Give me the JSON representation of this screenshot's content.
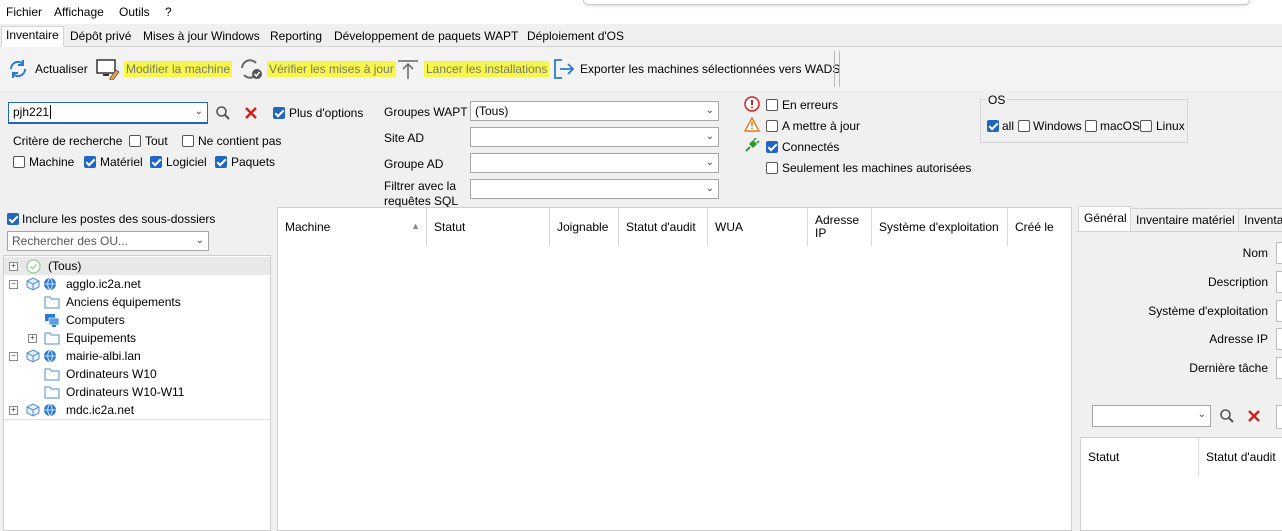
{
  "menu": [
    "Fichier",
    "Affichage",
    "Outils",
    "?"
  ],
  "tabs": [
    {
      "label": "Inventaire",
      "active": true
    },
    {
      "label": "Dépôt privé"
    },
    {
      "label": "Mises à jour Windows"
    },
    {
      "label": "Reporting"
    },
    {
      "label": "Développement de paquets WAPT"
    },
    {
      "label": "Déploiement d'OS"
    }
  ],
  "toolbar": {
    "refresh": "Actualiser",
    "edit_machine": "Modifier la machine",
    "check_updates": "Vérifier les mises à jour",
    "launch_installs": "Lancer les installations",
    "export_wads": "Exporter les machines sélectionnées vers WADS"
  },
  "search": {
    "value": "pjh221",
    "more_options": "Plus d'options",
    "criteria_label": "Critère de recherche",
    "all": "Tout",
    "not_contains": "Ne contient pas",
    "machine": "Machine",
    "hardware": "Matériel",
    "software": "Logiciel",
    "packages": "Paquets"
  },
  "filters": {
    "wapt_groups_label": "Groupes WAPT",
    "wapt_groups_value": "(Tous)",
    "ad_site_label": "Site AD",
    "ad_group_label": "Groupe AD",
    "sql_label_1": "Filtrer avec la",
    "sql_label_2": "requêtes SQL"
  },
  "status_filters": {
    "errors": "En erreurs",
    "to_update": "A mettre à jour",
    "connected": "Connectés",
    "authorized_only": "Seulement les machines autorisées"
  },
  "os": {
    "title": "OS",
    "all": "all",
    "windows": "Windows",
    "macos": "macOS",
    "linux": "Linux"
  },
  "ou": {
    "include_subfolders": "Inclure les postes des sous-dossiers",
    "search_placeholder": "Rechercher des OU...",
    "tree": [
      {
        "label": "(Tous)"
      },
      {
        "label": "agglo.ic2a.net"
      },
      {
        "label": "Anciens équipements"
      },
      {
        "label": "Computers"
      },
      {
        "label": "Equipements"
      },
      {
        "label": "mairie-albi.lan"
      },
      {
        "label": "Ordinateurs W10"
      },
      {
        "label": "Ordinateurs W10-W11"
      },
      {
        "label": "mdc.ic2a.net"
      }
    ]
  },
  "grid": {
    "columns": [
      "Machine",
      "Statut",
      "Joignable",
      "Statut d'audit",
      "WUA",
      "Adresse IP",
      "Système d'exploitation",
      "Créé le"
    ]
  },
  "details": {
    "tabs": [
      "Général",
      "Inventaire matériel",
      "Inventa"
    ],
    "fields": [
      "Nom",
      "Description",
      "Système d'exploitation",
      "Adresse IP",
      "Dernière tâche"
    ],
    "sub_columns": [
      "Statut",
      "Statut d'audit"
    ]
  },
  "colors": {
    "highlight": "#f6f74a",
    "accent": "#2266c4",
    "error_red": "#d22020"
  }
}
